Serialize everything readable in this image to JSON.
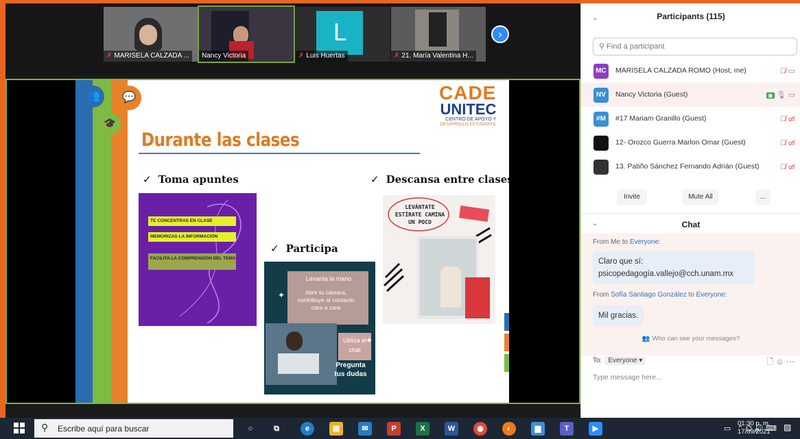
{
  "meeting": {
    "participants_strip": [
      {
        "name": "MARISELA CALZADA ...",
        "muted": true
      },
      {
        "name": "Nancy Victoria",
        "muted": false,
        "active": true
      },
      {
        "name": "Luis Huertas",
        "muted": true,
        "initial": "L"
      },
      {
        "name": "21. María Valentina H...",
        "muted": true
      }
    ]
  },
  "slide": {
    "title": "Durante las clases",
    "logo_line1": "CADE",
    "logo_line2": "UNITEC",
    "logo_line3": "CENTRO DE APOYO Y",
    "logo_line4": "DESARROLLO ESTUDIANTIL",
    "bullet1": "Toma apuntes",
    "bullet2": "Participa",
    "bullet3": "Descansa entre clases",
    "box1_lines": [
      "TE CONCENTRAS EN CLASE",
      "MEMORIZAS LA INFORMACIÓN",
      "FACILITA LA COMPRENSIÓN DEL TEMA"
    ],
    "box2_levanta": "Levanta la mano",
    "box2_abrir": "Abrir tu cámara, contribuye al contacto cara a cara",
    "box2_utiliza": "Utiliza el chat",
    "box2_pregunta": "Pregunta tus dudas",
    "box3_text": "LEVÁNTATE ESTÍRATE CAMINA UN POCO"
  },
  "participants_panel": {
    "title": "Participants (115)",
    "search_placeholder": "Find a participant",
    "list": [
      {
        "initials": "MC",
        "color": "#8a3fc4",
        "name": "MARISELA CALZADA ROMO (Host, me)"
      },
      {
        "initials": "NV",
        "color": "#3a8fd6",
        "name": "Nancy Victoria (Guest)"
      },
      {
        "initials": "#M",
        "color": "#3a8fd6",
        "name": "#17 Mariam Granillo (Guest)"
      },
      {
        "initials": "",
        "color": "#111111",
        "name": "12- Orozco Guerra Marlon Omar (Guest)"
      },
      {
        "initials": "",
        "color": "#333333",
        "name": "13. Patiño Sánchez Fernando Adrián (Guest)"
      }
    ],
    "invite": "Invite",
    "mute_all": "Mute All",
    "more": "..."
  },
  "chat": {
    "title": "Chat",
    "msg1_from_prefix": "From Me to",
    "msg1_to": "Everyone:",
    "msg1_line1": "Claro que sí:",
    "msg1_line2": "psicopedagogía.vallejo@cch.unam.mx",
    "msg2_from_prefix": "From",
    "msg2_sender": "Sofía Santiago González",
    "msg2_mid": "to",
    "msg2_to": "Everyone:",
    "msg2_text": "Mil gracias.",
    "who_can_see": "Who can see your messages?",
    "to_label": "To:",
    "to_value": "Everyone ▾",
    "placeholder": "Type message here..."
  },
  "taskbar": {
    "search_text": "Escribe aquí para buscar",
    "time": "01:30 p. m.",
    "date": "17/09/2021"
  }
}
